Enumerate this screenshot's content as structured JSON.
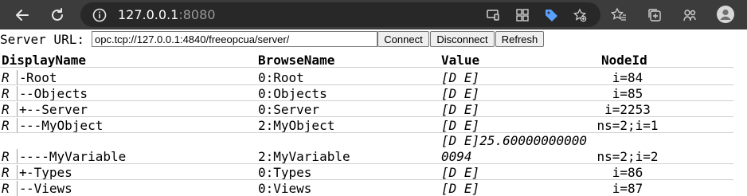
{
  "browser": {
    "url_host": "127.0.0.1",
    "url_port": ":8080",
    "icons": [
      "back-icon",
      "reload-icon",
      "site-info-icon",
      "cast-icon",
      "apps-icon",
      "tag-icon",
      "add-bookmark-icon",
      "favorites-icon",
      "collections-icon",
      "extensions-icon",
      "profile-icon"
    ]
  },
  "server": {
    "label": "Server URL:",
    "url_value": "opc.tcp://127.0.0.1:4840/freeopcua/server/",
    "connect_label": "Connect",
    "disconnect_label": "Disconnect",
    "refresh_label": "Refresh"
  },
  "table": {
    "headers": [
      "DisplayName",
      "BrowseName",
      "Value",
      "NodeId"
    ],
    "rows": [
      {
        "r": "R",
        "toggle": "-",
        "display": "Root",
        "browse": "0:Root",
        "value": "[D E]",
        "nodeid": "i=84"
      },
      {
        "r": "R",
        "toggle": "-",
        "display": "-Objects",
        "browse": "0:Objects",
        "value": "[D E]",
        "nodeid": "i=85"
      },
      {
        "r": "R",
        "toggle": "+",
        "display": "--Server",
        "browse": "0:Server",
        "value": "[D E]",
        "nodeid": "i=2253"
      },
      {
        "r": "R",
        "toggle": "-",
        "display": "--MyObject",
        "browse": "2:MyObject",
        "value": "[D E]",
        "nodeid": "ns=2;i=1"
      },
      {
        "r": "R",
        "toggle": "-",
        "display": "---MyVariable",
        "browse": "2:MyVariable",
        "value": "[D E]",
        "value_extra_line1": "25.60000000000",
        "value_extra_line2": "0094",
        "nodeid": "ns=2;i=2"
      },
      {
        "r": "R",
        "toggle": "+",
        "display": "-Types",
        "browse": "0:Types",
        "value": "[D E]",
        "nodeid": "i=86"
      },
      {
        "r": "R",
        "toggle": "-",
        "display": "-Views",
        "browse": "0:Views",
        "value": "[D E]",
        "nodeid": "i=87"
      }
    ]
  }
}
